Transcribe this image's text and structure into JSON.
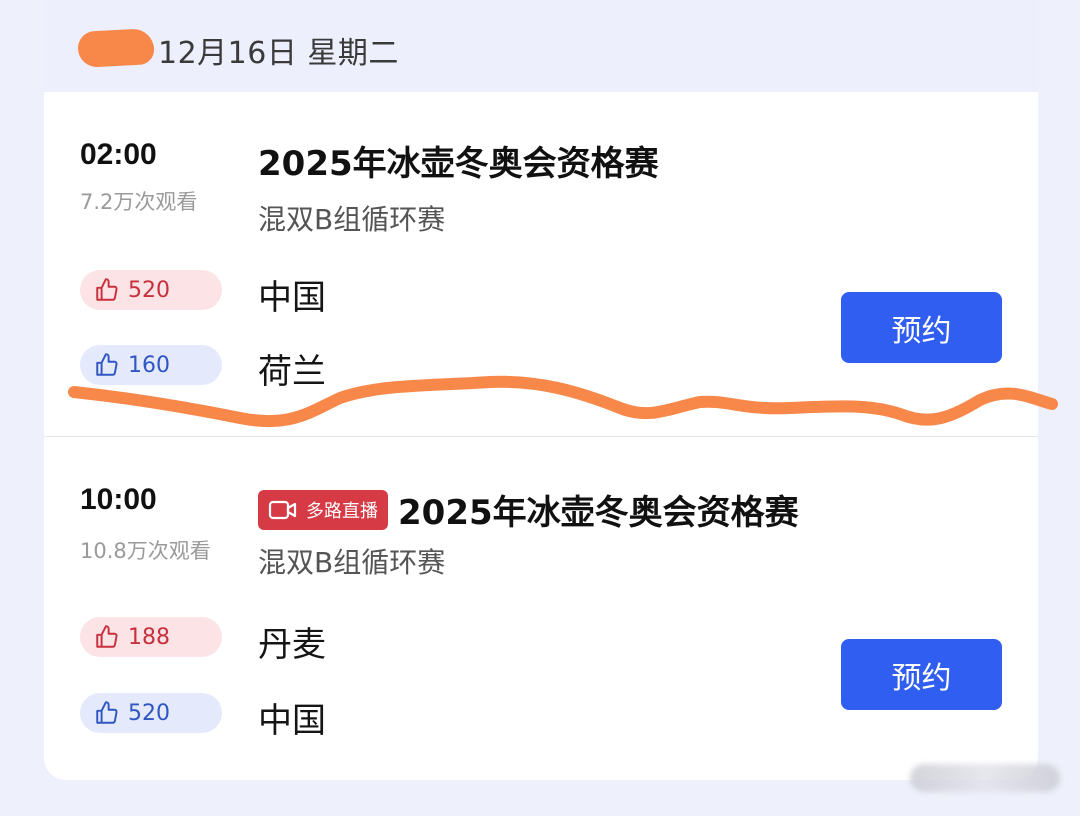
{
  "schedule": {
    "date_label": "12月16日 星期二"
  },
  "matches": [
    {
      "time": "02:00",
      "views": "7.2万次观看",
      "title": "2025年冰壶冬奥会资格赛",
      "subtitle": "混双B组循环赛",
      "team_a": {
        "name": "中国",
        "likes": "520"
      },
      "team_b": {
        "name": "荷兰",
        "likes": "160"
      },
      "button_label": "预约"
    },
    {
      "time": "10:00",
      "views": "10.8万次观看",
      "badge": "多路直播",
      "title": "2025年冰壶冬奥会资格赛",
      "subtitle": "混双B组循环赛",
      "team_a": {
        "name": "丹麦",
        "likes": "188"
      },
      "team_b": {
        "name": "中国",
        "likes": "520"
      },
      "button_label": "预约"
    }
  ],
  "colors": {
    "accent": "#2f5ef0",
    "like_red": "#c8303c",
    "like_blue": "#2f56c2",
    "badge_red": "#d63a44",
    "scribble": "#f7884a"
  },
  "icons": {
    "like": "thumbs-up-icon",
    "live": "video-camera-icon"
  }
}
